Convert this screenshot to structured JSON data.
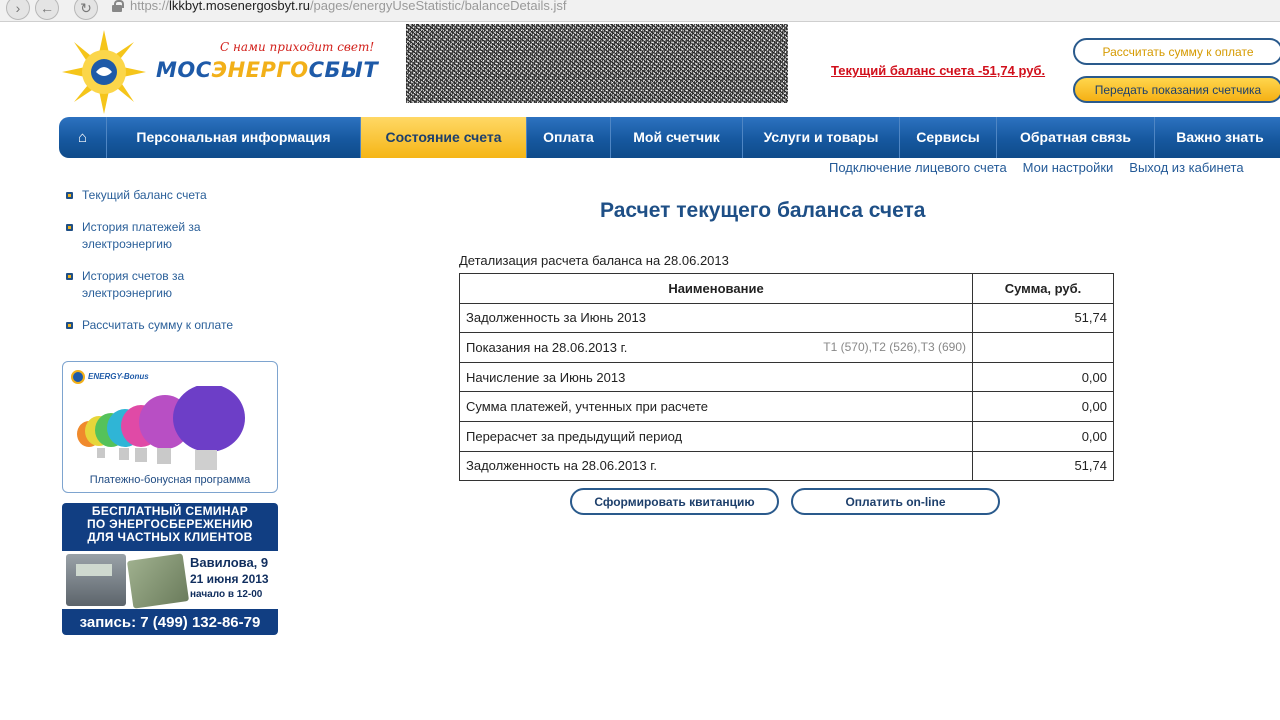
{
  "browser": {
    "url_prefix": "https://",
    "url_host": "lkkbyt.mosenergosbyt.ru",
    "url_path": "/pages/energyUseStatistic/balanceDetails.jsf"
  },
  "header": {
    "slogan": "С нами приходит свет!",
    "brand_part1": "МОС",
    "brand_part2": "ЭНЕРГО",
    "brand_part3": "СБЫТ",
    "balance_link": "Текущий баланс счета -51,74 руб.",
    "calc_button": "Рассчитать сумму к оплате",
    "meter_button": "Передать показания счетчика"
  },
  "nav": {
    "home_icon": "⌂",
    "items": [
      "Персональная информация",
      "Состояние счета",
      "Оплата",
      "Мой счетчик",
      "Услуги и товары",
      "Сервисы",
      "Обратная связь",
      "Важно знать"
    ],
    "active_index": 1
  },
  "sub_links": [
    "Подключение лицевого счета",
    "Мои настройки",
    "Выход из кабинета"
  ],
  "sidebar": {
    "items": [
      "Текущий баланс счета",
      "История платежей за электроэнергию",
      "История счетов за электроэнергию",
      "Рассчитать сумму к оплате"
    ],
    "promo1": {
      "logo": "ENERGY-Bonus",
      "caption": "Платежно-бонусная программа"
    },
    "promo2": {
      "line1": "БЕСПЛАТНЫЙ СЕМИНАР",
      "line2": "ПО ЭНЕРГОСБЕРЕЖЕНИЮ",
      "line3": "ДЛЯ ЧАСТНЫХ КЛИЕНТОВ",
      "address": "Вавилова, 9",
      "date": "21 июня 2013",
      "time": "начало в 12-00",
      "phone": "запись: 7 (499) 132-86-79"
    }
  },
  "main": {
    "title": "Расчет текущего баланса счета",
    "caption": "Детализация расчета баланса на 28.06.2013",
    "table": {
      "headers": [
        "Наименование",
        "Сумма, руб."
      ],
      "rows": [
        {
          "name": "Задолженность за Июнь 2013",
          "extra": "",
          "sum": "51,74"
        },
        {
          "name": "Показания на 28.06.2013 г.",
          "extra": "Т1 (570),Т2 (526),Т3 (690)",
          "sum": ""
        },
        {
          "name": "Начисление за Июнь 2013",
          "extra": "",
          "sum": "0,00"
        },
        {
          "name": "Сумма платежей, учтенных при расчете",
          "extra": "",
          "sum": "0,00"
        },
        {
          "name": "Перерасчет за предыдущий период",
          "extra": "",
          "sum": "0,00"
        },
        {
          "name": "Задолженность на 28.06.2013 г.",
          "extra": "",
          "sum": "51,74"
        }
      ]
    },
    "receipt_button": "Сформировать квитанцию",
    "pay_button": "Оплатить on-line"
  },
  "colors": {
    "nav_blue": "#16589f",
    "active_yellow": "#f5b516",
    "link_blue": "#245a97",
    "alert_red": "#d10f1b"
  }
}
